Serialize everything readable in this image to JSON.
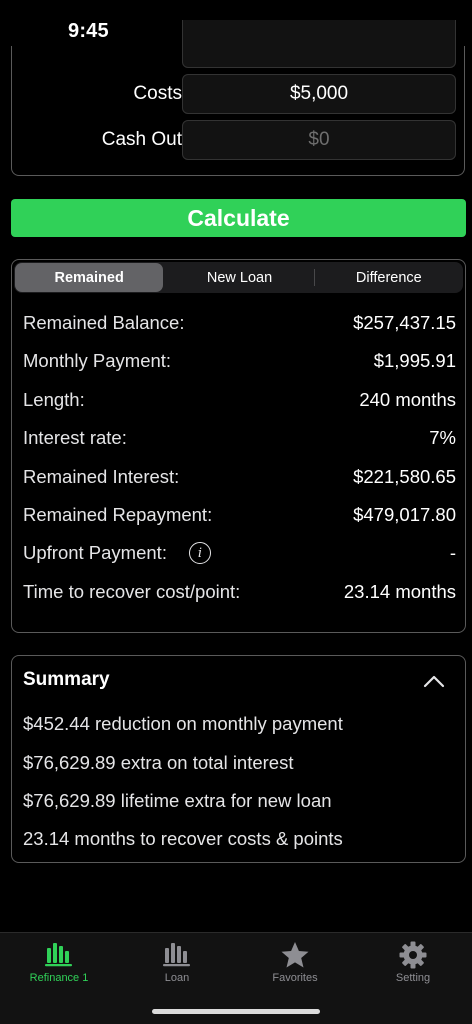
{
  "status": {
    "time": "9:45"
  },
  "inputs": {
    "costs_label": "Costs",
    "costs_value": "$5,000",
    "cashout_label": "Cash Out",
    "cashout_placeholder": "$0"
  },
  "calculate_label": "Calculate",
  "segments": [
    {
      "label": "Remained",
      "active": true
    },
    {
      "label": "New Loan",
      "active": false
    },
    {
      "label": "Difference",
      "active": false
    }
  ],
  "results": [
    {
      "label": "Remained Balance:",
      "value": "$257,437.15"
    },
    {
      "label": "Monthly Payment:",
      "value": "$1,995.91"
    },
    {
      "label": "Length:",
      "value": "240 months"
    },
    {
      "label": "Interest rate:",
      "value": "7%"
    },
    {
      "label": "Remained Interest:",
      "value": "$221,580.65"
    },
    {
      "label": "Remained Repayment:",
      "value": "$479,017.80"
    },
    {
      "label": "Upfront Payment:",
      "value": "-"
    },
    {
      "label": "Time to recover cost/point:",
      "value": "23.14 months"
    }
  ],
  "summary": {
    "title": "Summary",
    "lines": [
      "$452.44 reduction on monthly payment",
      "$76,629.89 extra on total interest",
      "$76,629.89 lifetime extra for new loan",
      "23.14 months to recover costs & points"
    ]
  },
  "tabs": [
    {
      "label": "Refinance 1",
      "icon": "bar-chart-icon",
      "active": true
    },
    {
      "label": "Loan",
      "icon": "bar-chart-icon",
      "active": false
    },
    {
      "label": "Favorites",
      "icon": "star-icon",
      "active": false
    },
    {
      "label": "Setting",
      "icon": "gear-icon",
      "active": false
    }
  ],
  "colors": {
    "accent": "#30d158",
    "inactive_tab": "#8e8e93",
    "background": "#000000"
  }
}
